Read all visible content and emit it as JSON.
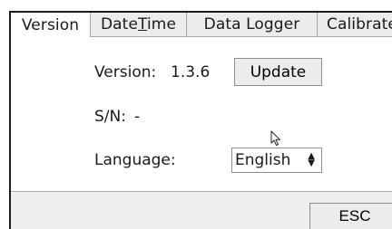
{
  "tabs": [
    {
      "label": "Version",
      "active": true
    },
    {
      "label_pre": "Date",
      "label_mnemonic": "T",
      "label_post": "ime",
      "active": false
    },
    {
      "label": "Data Logger",
      "active": false
    },
    {
      "label": "Calibrate",
      "active": false
    }
  ],
  "version": {
    "label": "Version:",
    "value": "1.3.6",
    "update_button": "Update"
  },
  "serial": {
    "label": "S/N:",
    "value": "-"
  },
  "language": {
    "label": "Language:",
    "selected": "English",
    "arrows_icon": "updown-spinner-icon"
  },
  "footer": {
    "esc_button": "ESC"
  },
  "colors": {
    "tab_inactive_bg": "#ececec",
    "footer_bg": "#efefef",
    "border": "#a9a9a9"
  }
}
